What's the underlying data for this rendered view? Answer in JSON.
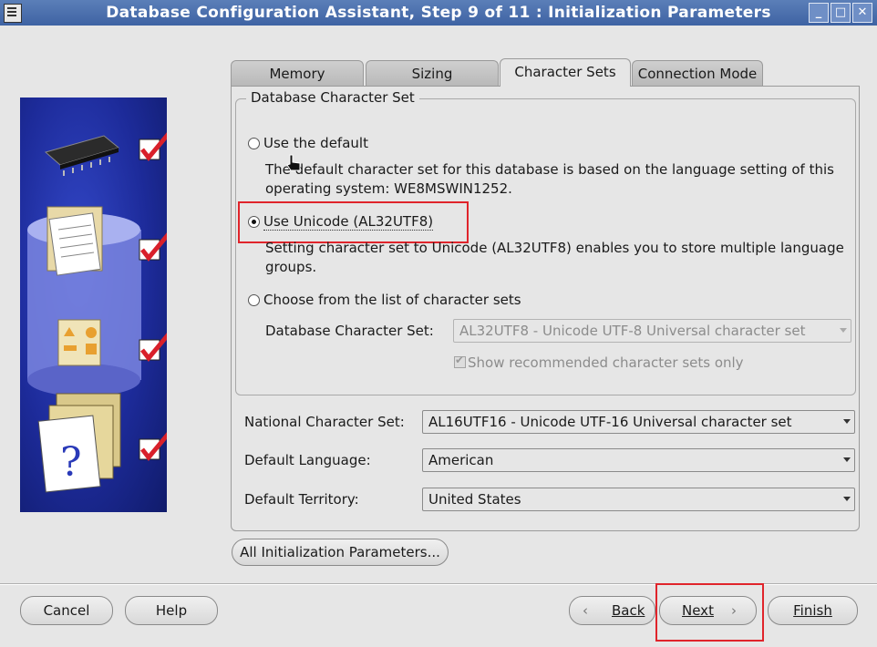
{
  "window": {
    "title": "Database Configuration Assistant, Step 9 of 11 : Initialization Parameters"
  },
  "tabs": [
    {
      "label": "Memory",
      "active": false
    },
    {
      "label": "Sizing",
      "active": false
    },
    {
      "label": "Character Sets",
      "active": true
    },
    {
      "label": "Connection Mode",
      "active": false
    }
  ],
  "db_charset": {
    "legend": "Database Character Set",
    "option_default": {
      "label": "Use the default",
      "desc_line1": "The default character set for this database is based on the language setting of this",
      "desc_line2": "operating system: WE8MSWIN1252."
    },
    "option_unicode": {
      "label": "Use Unicode (AL32UTF8)",
      "desc_line1": "Setting character set to Unicode (AL32UTF8) enables you to store multiple language",
      "desc_line2": "groups."
    },
    "option_choose": {
      "label": "Choose from the list of character sets",
      "field_label": "Database Character Set:",
      "field_value": "AL32UTF8 - Unicode UTF-8 Universal character set",
      "show_recommended": "Show recommended character sets only"
    },
    "selected": "unicode"
  },
  "national_charset": {
    "label": "National Character Set:",
    "value": "AL16UTF16 - Unicode UTF-16 Universal character set"
  },
  "default_language": {
    "label": "Default Language:",
    "value": "American"
  },
  "default_territory": {
    "label": "Default Territory:",
    "value": "United States"
  },
  "buttons": {
    "all_params": "All Initialization Parameters...",
    "cancel": "Cancel",
    "help": "Help",
    "back": "Back",
    "next": "Next",
    "finish": "Finish"
  },
  "colors": {
    "highlight": "#e0242b",
    "titlebar": "#4a6eae",
    "sidebar": "#1d2b9a"
  }
}
